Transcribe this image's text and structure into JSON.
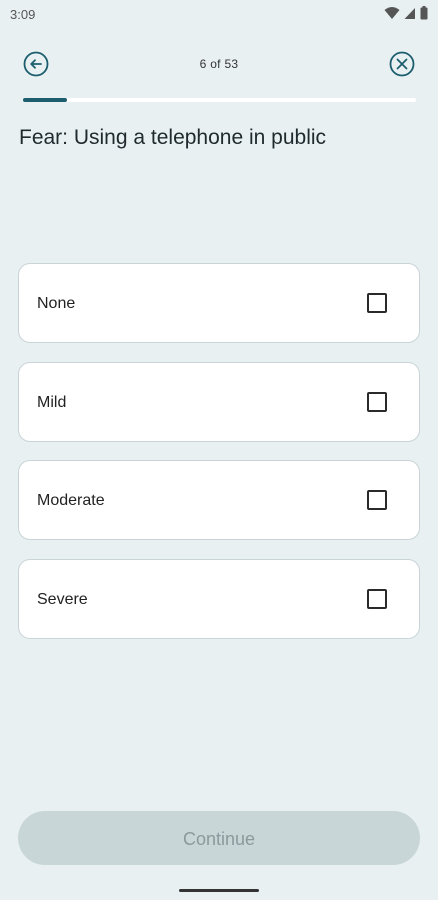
{
  "status_bar": {
    "time": "3:09",
    "icons": [
      "wifi-icon",
      "signal-icon",
      "battery-icon"
    ]
  },
  "header": {
    "back_icon": "arrow-left-circle-icon",
    "close_icon": "close-circle-icon",
    "counter": "6 of 53"
  },
  "progress": {
    "current": 6,
    "total": 53
  },
  "question": "Fear: Using a telephone in public",
  "options": [
    {
      "label": "None",
      "checked": false
    },
    {
      "label": "Mild",
      "checked": false
    },
    {
      "label": "Moderate",
      "checked": false
    },
    {
      "label": "Severe",
      "checked": false
    }
  ],
  "continue_label": "Continue",
  "colors": {
    "background": "#e8f0f2",
    "accent": "#1d5e6e",
    "button_disabled": "#c8d6d8",
    "button_disabled_text": "#8a9a9d"
  }
}
